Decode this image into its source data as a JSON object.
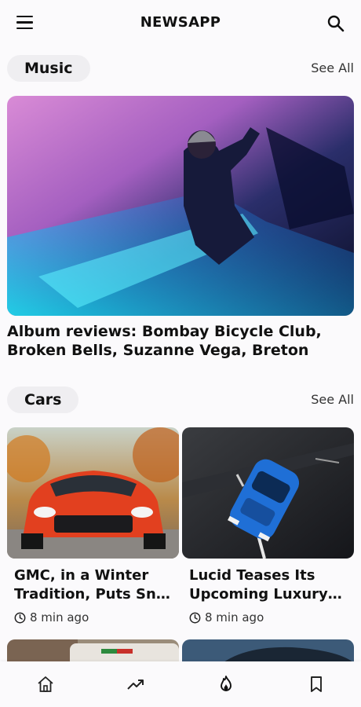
{
  "header": {
    "title": "NEWSAPP"
  },
  "sections": {
    "music": {
      "label": "Music",
      "see_all": "See All",
      "hero_title": "Album reviews: Bombay Bicycle Club, Broken Bells, Suzanne Vega, Breton"
    },
    "cars": {
      "label": "Cars",
      "see_all": "See All",
      "cards": [
        {
          "title_l1": "GMC, in a Winter",
          "title_l2": "Tradition, Puts Sno…",
          "time": "8 min ago"
        },
        {
          "title_l1": "Lucid Teases Its",
          "title_l2": "Upcoming Luxury …",
          "time": "8 min ago"
        }
      ]
    }
  },
  "bottom_nav": [
    "home-icon",
    "trending-icon",
    "fire-icon",
    "bookmark-icon"
  ],
  "colors": {
    "background": "#fbfafc",
    "pill": "#efeef1",
    "text": "#111111"
  }
}
